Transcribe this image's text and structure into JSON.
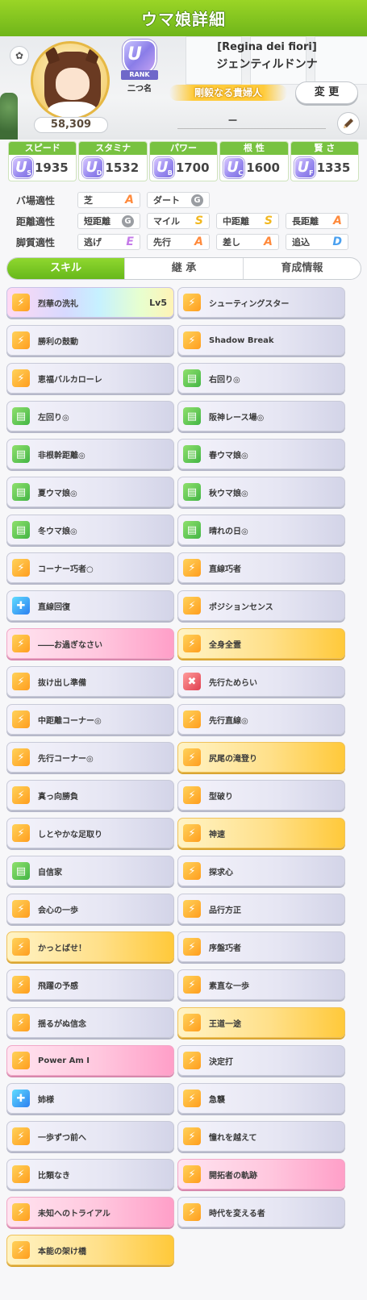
{
  "header": {
    "title": "ウマ娘詳細"
  },
  "profile": {
    "rating": "58,309",
    "rank_badge": {
      "letter": "U",
      "label": "RANK",
      "sub": "二つ名"
    },
    "epithet": "[Regina dei fiori]",
    "name": "ジェンティルドンナ",
    "title": "剛毅なる貴婦人",
    "change_label": "変 更",
    "memo": "－"
  },
  "stats": [
    {
      "label": "スピード",
      "icon": "shoe-icon",
      "grade": "U",
      "grade_sub": "S",
      "value": "1935"
    },
    {
      "label": "スタミナ",
      "icon": "heart-icon",
      "grade": "U",
      "grade_sub": "D",
      "value": "1532"
    },
    {
      "label": "パワー",
      "icon": "muscle-icon",
      "grade": "U",
      "grade_sub": "B",
      "value": "1700"
    },
    {
      "label": "根 性",
      "icon": "flame-icon",
      "grade": "U",
      "grade_sub": "C",
      "value": "1600"
    },
    {
      "label": "賢 さ",
      "icon": "graduation-cap-icon",
      "grade": "U",
      "grade_sub": "F",
      "value": "1335"
    }
  ],
  "aptitudes": {
    "track": {
      "label": "バ場適性",
      "items": [
        {
          "name": "芝",
          "grade": "A"
        },
        {
          "name": "ダート",
          "grade": "G"
        }
      ]
    },
    "distance": {
      "label": "距離適性",
      "items": [
        {
          "name": "短距離",
          "grade": "G"
        },
        {
          "name": "マイル",
          "grade": "S"
        },
        {
          "name": "中距離",
          "grade": "S"
        },
        {
          "name": "長距離",
          "grade": "A"
        }
      ]
    },
    "style": {
      "label": "脚質適性",
      "items": [
        {
          "name": "逃げ",
          "grade": "E"
        },
        {
          "name": "先行",
          "grade": "A"
        },
        {
          "name": "差し",
          "grade": "A"
        },
        {
          "name": "追込",
          "grade": "D"
        }
      ]
    }
  },
  "tabs": [
    {
      "label": "スキル",
      "active": true
    },
    {
      "label": "継 承",
      "active": false
    },
    {
      "label": "育成情報",
      "active": false
    }
  ],
  "skills": [
    {
      "name": "烈華の洗礼",
      "level": "Lv5",
      "style": "rainbow",
      "icon": "orange"
    },
    {
      "name": "シューティングスター",
      "level": "",
      "style": "plain",
      "icon": "orange"
    },
    {
      "name": "勝利の鼓動",
      "level": "",
      "style": "plain",
      "icon": "orange"
    },
    {
      "name": "Shadow Break",
      "level": "",
      "style": "plain",
      "icon": "orange"
    },
    {
      "name": "恵福バルカローレ",
      "level": "",
      "style": "plain",
      "icon": "orange"
    },
    {
      "name": "右回り◎",
      "level": "",
      "style": "plain",
      "icon": "green"
    },
    {
      "name": "左回り◎",
      "level": "",
      "style": "plain",
      "icon": "green"
    },
    {
      "name": "阪神レース場◎",
      "level": "",
      "style": "plain",
      "icon": "green"
    },
    {
      "name": "非根幹距離◎",
      "level": "",
      "style": "plain",
      "icon": "green"
    },
    {
      "name": "春ウマ娘◎",
      "level": "",
      "style": "plain",
      "icon": "green"
    },
    {
      "name": "夏ウマ娘◎",
      "level": "",
      "style": "plain",
      "icon": "green"
    },
    {
      "name": "秋ウマ娘◎",
      "level": "",
      "style": "plain",
      "icon": "green"
    },
    {
      "name": "冬ウマ娘◎",
      "level": "",
      "style": "plain",
      "icon": "green"
    },
    {
      "name": "晴れの日◎",
      "level": "",
      "style": "plain",
      "icon": "green"
    },
    {
      "name": "コーナー巧者○",
      "level": "",
      "style": "plain",
      "icon": "orange"
    },
    {
      "name": "直線巧者",
      "level": "",
      "style": "plain",
      "icon": "orange"
    },
    {
      "name": "直線回復",
      "level": "",
      "style": "plain",
      "icon": "blue"
    },
    {
      "name": "ポジションセンス",
      "level": "",
      "style": "plain",
      "icon": "orange"
    },
    {
      "name": "――お過ぎなさい",
      "level": "",
      "style": "pink",
      "icon": "orange"
    },
    {
      "name": "全身全霊",
      "level": "",
      "style": "gold",
      "icon": "orange"
    },
    {
      "name": "抜け出し準備",
      "level": "",
      "style": "plain",
      "icon": "orange"
    },
    {
      "name": "先行ためらい",
      "level": "",
      "style": "plain",
      "icon": "red"
    },
    {
      "name": "中距離コーナー◎",
      "level": "",
      "style": "plain",
      "icon": "orange"
    },
    {
      "name": "先行直線◎",
      "level": "",
      "style": "plain",
      "icon": "orange"
    },
    {
      "name": "先行コーナー◎",
      "level": "",
      "style": "plain",
      "icon": "orange"
    },
    {
      "name": "尻尾の滝登り",
      "level": "",
      "style": "gold",
      "icon": "orange"
    },
    {
      "name": "真っ向勝負",
      "level": "",
      "style": "plain",
      "icon": "orange"
    },
    {
      "name": "型破り",
      "level": "",
      "style": "plain",
      "icon": "orange"
    },
    {
      "name": "しとやかな足取り",
      "level": "",
      "style": "plain",
      "icon": "orange"
    },
    {
      "name": "神速",
      "level": "",
      "style": "gold",
      "icon": "orange"
    },
    {
      "name": "自信家",
      "level": "",
      "style": "plain",
      "icon": "green"
    },
    {
      "name": "探求心",
      "level": "",
      "style": "plain",
      "icon": "orange"
    },
    {
      "name": "会心の一歩",
      "level": "",
      "style": "plain",
      "icon": "orange"
    },
    {
      "name": "品行方正",
      "level": "",
      "style": "plain",
      "icon": "orange"
    },
    {
      "name": "かっとばせ！",
      "level": "",
      "style": "gold",
      "icon": "orange"
    },
    {
      "name": "序盤巧者",
      "level": "",
      "style": "plain",
      "icon": "orange"
    },
    {
      "name": "飛躍の予感",
      "level": "",
      "style": "plain",
      "icon": "orange"
    },
    {
      "name": "素直な一歩",
      "level": "",
      "style": "plain",
      "icon": "orange"
    },
    {
      "name": "揺るがぬ信念",
      "level": "",
      "style": "plain",
      "icon": "orange"
    },
    {
      "name": "王道一途",
      "level": "",
      "style": "gold",
      "icon": "orange"
    },
    {
      "name": "Power Am I",
      "level": "",
      "style": "pink",
      "icon": "orange"
    },
    {
      "name": "決定打",
      "level": "",
      "style": "plain",
      "icon": "orange"
    },
    {
      "name": "姉様",
      "level": "",
      "style": "plain",
      "icon": "blue"
    },
    {
      "name": "急襲",
      "level": "",
      "style": "plain",
      "icon": "orange"
    },
    {
      "name": "一歩ずつ前へ",
      "level": "",
      "style": "plain",
      "icon": "orange"
    },
    {
      "name": "憧れを越えて",
      "level": "",
      "style": "plain",
      "icon": "orange"
    },
    {
      "name": "比類なき",
      "level": "",
      "style": "plain",
      "icon": "orange"
    },
    {
      "name": "開拓者の軌跡",
      "level": "",
      "style": "pink",
      "icon": "orange"
    },
    {
      "name": "未知へのトライアル",
      "level": "",
      "style": "pink",
      "icon": "orange"
    },
    {
      "name": "時代を変える者",
      "level": "",
      "style": "plain",
      "icon": "orange"
    },
    {
      "name": "本能の架け橋",
      "level": "",
      "style": "gold",
      "icon": "orange"
    }
  ]
}
